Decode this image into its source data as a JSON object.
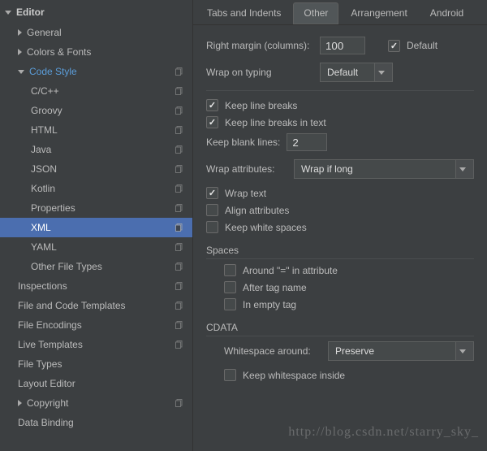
{
  "sidebar": {
    "title": "Editor",
    "items": [
      {
        "label": "General",
        "expandable": true,
        "indent": 0
      },
      {
        "label": "Colors & Fonts",
        "expandable": true,
        "indent": 0
      },
      {
        "label": "Code Style",
        "expandable": true,
        "expanded": true,
        "indent": 0,
        "highlight": true,
        "copy": true
      },
      {
        "label": "C/C++",
        "indent": 1,
        "copy": true
      },
      {
        "label": "Groovy",
        "indent": 1,
        "copy": true
      },
      {
        "label": "HTML",
        "indent": 1,
        "copy": true
      },
      {
        "label": "Java",
        "indent": 1,
        "copy": true
      },
      {
        "label": "JSON",
        "indent": 1,
        "copy": true
      },
      {
        "label": "Kotlin",
        "indent": 1,
        "copy": true
      },
      {
        "label": "Properties",
        "indent": 1,
        "copy": true
      },
      {
        "label": "XML",
        "indent": 1,
        "copy": true,
        "selected": true
      },
      {
        "label": "YAML",
        "indent": 1,
        "copy": true
      },
      {
        "label": "Other File Types",
        "indent": 1,
        "copy": true
      },
      {
        "label": "Inspections",
        "indent": 0,
        "copy": true
      },
      {
        "label": "File and Code Templates",
        "indent": 0,
        "copy": true
      },
      {
        "label": "File Encodings",
        "indent": 0,
        "copy": true
      },
      {
        "label": "Live Templates",
        "indent": 0,
        "copy": true
      },
      {
        "label": "File Types",
        "indent": 0
      },
      {
        "label": "Layout Editor",
        "indent": 0
      },
      {
        "label": "Copyright",
        "expandable": true,
        "indent": 0,
        "copy": true
      },
      {
        "label": "Data Binding",
        "indent": 0
      }
    ]
  },
  "tabs": [
    {
      "label": "Tabs and Indents",
      "active": false
    },
    {
      "label": "Other",
      "active": true
    },
    {
      "label": "Arrangement",
      "active": false
    },
    {
      "label": "Android",
      "active": false
    }
  ],
  "form": {
    "right_margin_label": "Right margin (columns):",
    "right_margin_value": "100",
    "default_label": "Default",
    "default_checked": true,
    "wrap_on_typing_label": "Wrap on typing",
    "wrap_on_typing_value": "Default",
    "keep_line_breaks": {
      "label": "Keep line breaks",
      "checked": true
    },
    "keep_line_breaks_text": {
      "label": "Keep line breaks in text",
      "checked": true
    },
    "keep_blank_lines_label": "Keep blank lines:",
    "keep_blank_lines_value": "2",
    "wrap_attributes_label": "Wrap attributes:",
    "wrap_attributes_value": "Wrap if long",
    "wrap_text": {
      "label": "Wrap text",
      "checked": true
    },
    "align_attributes": {
      "label": "Align attributes",
      "checked": false
    },
    "keep_white_spaces": {
      "label": "Keep white spaces",
      "checked": false
    },
    "spaces_title": "Spaces",
    "around_equals": {
      "label": "Around \"=\" in attribute",
      "checked": false
    },
    "after_tag_name": {
      "label": "After tag name",
      "checked": false
    },
    "in_empty_tag": {
      "label": "In empty tag",
      "checked": false
    },
    "cdata_title": "CDATA",
    "whitespace_around_label": "Whitespace around:",
    "whitespace_around_value": "Preserve",
    "keep_whitespace_inside": {
      "label": "Keep whitespace inside",
      "checked": false
    }
  },
  "watermark": "http://blog.csdn.net/starry_sky_"
}
